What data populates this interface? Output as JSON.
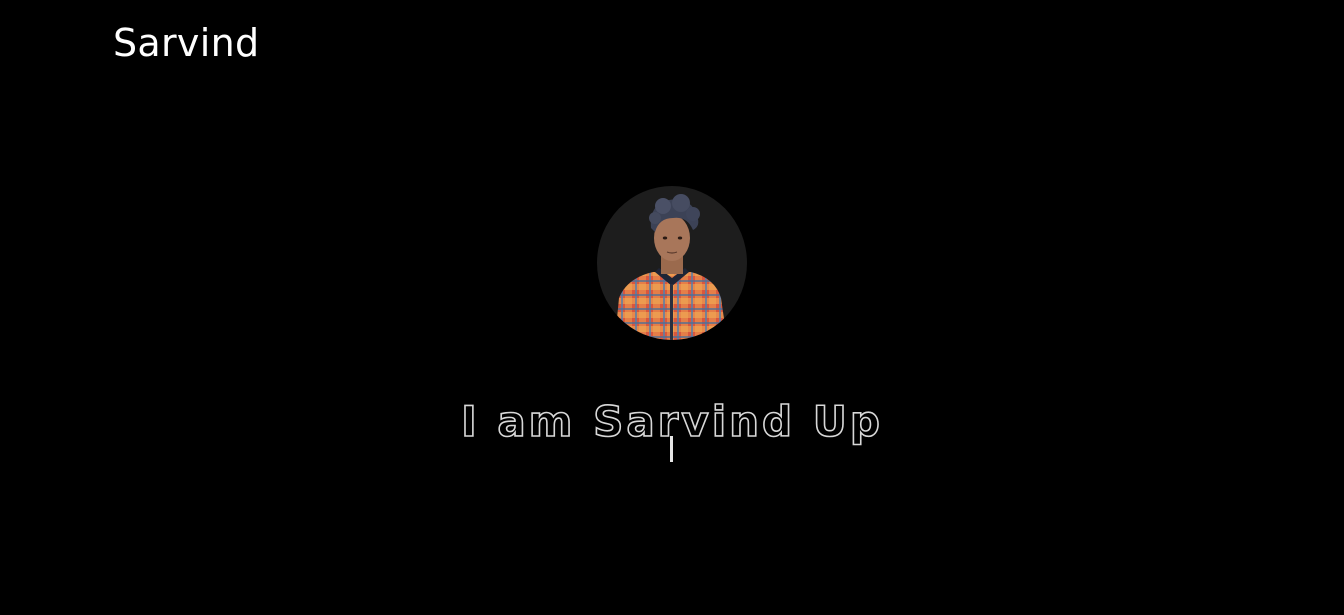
{
  "header": {
    "brand": "Sarvind"
  },
  "hero": {
    "avatar_icon": "profile-photo",
    "headline": "I am Sarvind Up"
  },
  "colors": {
    "background": "#000000",
    "text": "#ffffff",
    "avatar_bg": "#1d1d1d",
    "headline_stroke": "#d8d8d8"
  }
}
